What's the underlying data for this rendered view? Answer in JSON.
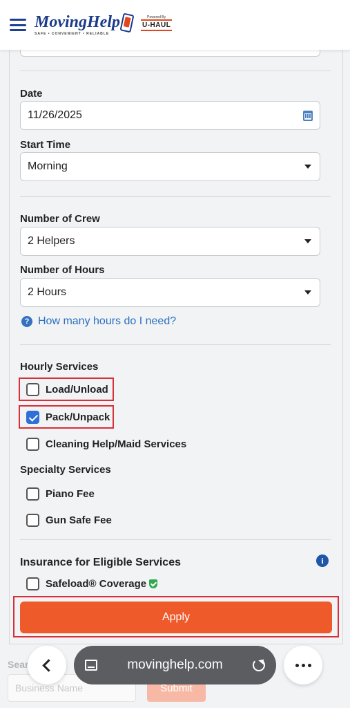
{
  "header": {
    "logo_word": "MovingHelp",
    "logo_tagline": "SAFE • CONVENIENT • RELIABLE",
    "powered_by": "Powered By",
    "uhaul": "U-HAUL"
  },
  "form": {
    "date_label": "Date",
    "date_value": "11/26/2025",
    "start_time_label": "Start Time",
    "start_time_value": "Morning",
    "crew_label": "Number of Crew",
    "crew_value": "2 Helpers",
    "hours_label": "Number of Hours",
    "hours_value": "2 Hours",
    "help_link": "How many hours do I need?",
    "hourly_services_label": "Hourly Services",
    "hourly_services": [
      {
        "label": "Load/Unload",
        "checked": false
      },
      {
        "label": "Pack/Unpack",
        "checked": true
      },
      {
        "label": "Cleaning Help/Maid Services",
        "checked": false
      }
    ],
    "specialty_services_label": "Specialty Services",
    "specialty_services": [
      {
        "label": "Piano Fee",
        "checked": false
      },
      {
        "label": "Gun Safe Fee",
        "checked": false
      }
    ],
    "insurance_label": "Insurance for Eligible Services",
    "insurance_option": {
      "label": "Safeload® Coverage",
      "checked": false
    },
    "apply_label": "Apply"
  },
  "background": {
    "search_text": "Sear",
    "business_placeholder": "Business Name",
    "submit_label": "Submit"
  },
  "browser": {
    "url": "movinghelp.com"
  },
  "colors": {
    "brand_blue": "#1a3a8a",
    "apply_orange": "#ee5a2a",
    "highlight_red": "#d8303a",
    "link_blue": "#2a6fbf",
    "checkbox_blue": "#2f6fd6"
  }
}
